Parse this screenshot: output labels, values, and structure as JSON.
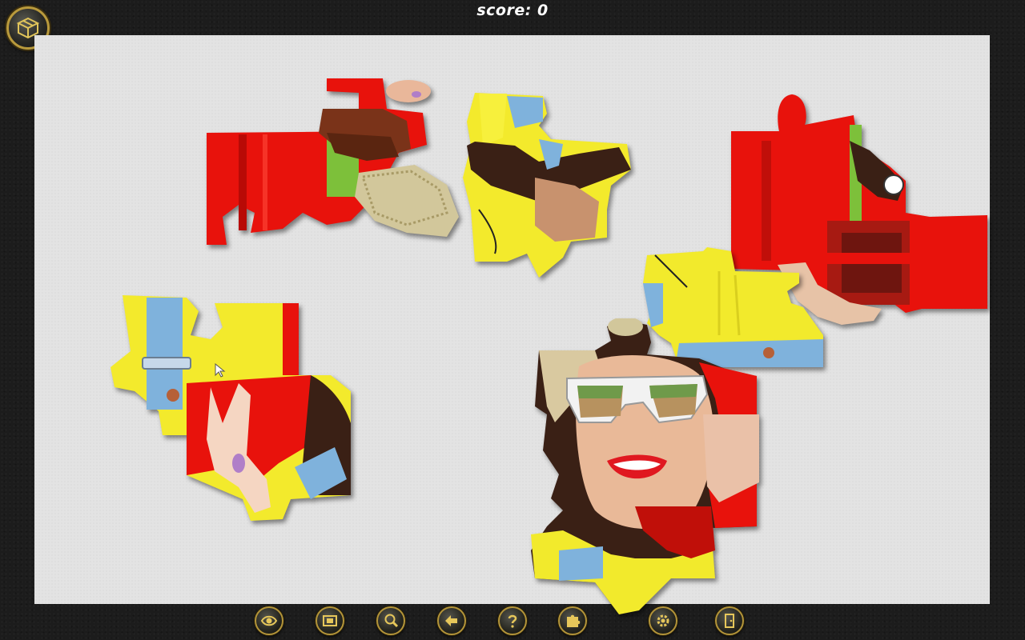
{
  "score": {
    "label": "score:",
    "value": "0"
  },
  "toolbar": {
    "buttons": [
      {
        "id": "preview",
        "icon": "eye-icon"
      },
      {
        "id": "background",
        "icon": "picture-frame-icon"
      },
      {
        "id": "zoom",
        "icon": "magnifier-icon"
      },
      {
        "id": "sort-edges",
        "icon": "arrows-icon"
      },
      {
        "id": "help",
        "icon": "question-mark-icon"
      },
      {
        "id": "hint",
        "icon": "puzzle-piece-icon"
      },
      {
        "id": "settings",
        "icon": "gear-icon"
      },
      {
        "id": "exit",
        "icon": "door-exit-icon"
      }
    ]
  },
  "colors": {
    "board": "#e3e3e3",
    "frame": "#1c1c1c",
    "gold": "#b39439",
    "piece_red": "#e8120c",
    "piece_yellow": "#f2ea2c",
    "piece_denim": "#7fb2dc"
  }
}
